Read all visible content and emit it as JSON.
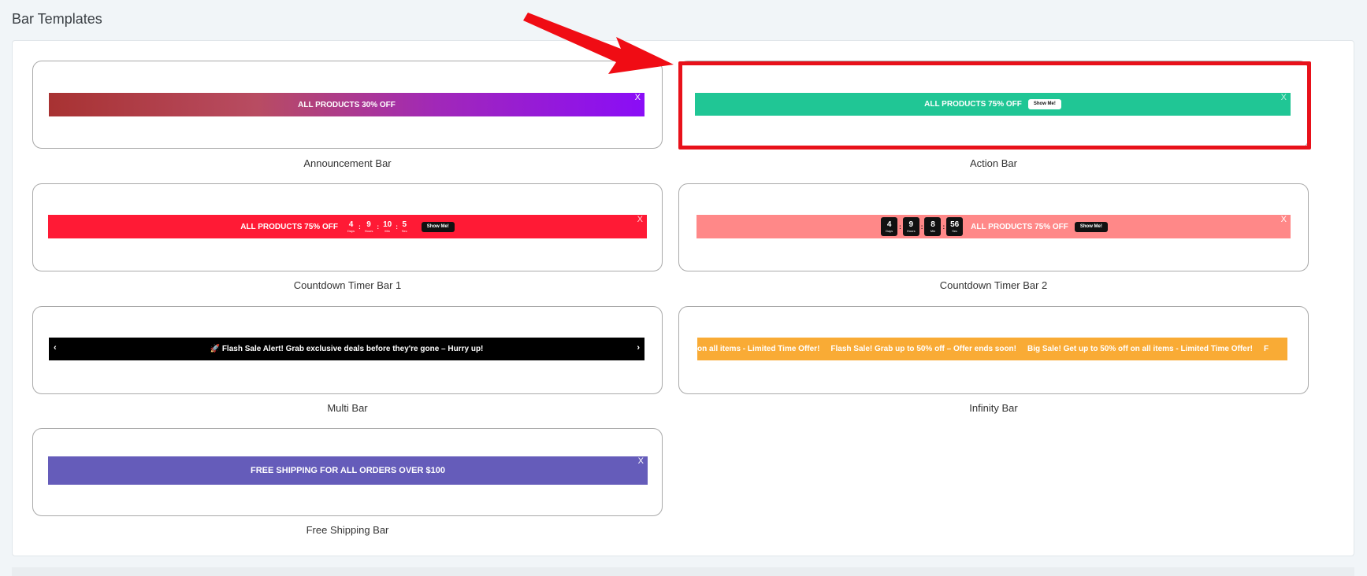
{
  "page": {
    "title": "Bar Templates"
  },
  "templates": [
    {
      "label": "Announcement Bar",
      "text": "ALL PRODUCTS 30% OFF",
      "close": "X"
    },
    {
      "label": "Action Bar",
      "text": "ALL PRODUCTS 75% OFF",
      "button": "Show Me!",
      "close": "X"
    },
    {
      "label": "Countdown Timer Bar 1",
      "text": "ALL PRODUCTS 75% OFF",
      "button": "Show Me!",
      "close": "X",
      "countdown": [
        {
          "value": "4",
          "unit": "Days"
        },
        {
          "value": "9",
          "unit": "Hours"
        },
        {
          "value": "10",
          "unit": "Min"
        },
        {
          "value": "5",
          "unit": "Sec"
        }
      ]
    },
    {
      "label": "Countdown Timer Bar 2",
      "text": "ALL PRODUCTS 75% OFF",
      "button": "Show Me!",
      "close": "X",
      "countdown": [
        {
          "value": "4",
          "unit": "Days"
        },
        {
          "value": "9",
          "unit": "Hours"
        },
        {
          "value": "8",
          "unit": "Min"
        },
        {
          "value": "56",
          "unit": "Sec"
        }
      ]
    },
    {
      "label": "Multi Bar",
      "text": "🚀 Flash Sale Alert! Grab exclusive deals before they're gone – Hurry up!",
      "prev": "‹",
      "next": "›"
    },
    {
      "label": "Infinity Bar",
      "marquee": [
        "on all items - Limited Time Offer!",
        "Flash Sale! Grab up to 50% off – Offer ends soon!",
        "Big Sale! Get up to 50% off on all items - Limited Time Offer!",
        "F"
      ]
    },
    {
      "label": "Free Shipping Bar",
      "text": "FREE SHIPPING FOR ALL ORDERS OVER $100",
      "close": "X"
    }
  ],
  "colors": {
    "announcement_gradient": [
      "#a83232",
      "#b84c62",
      "#8a0df7"
    ],
    "action": "#20c695",
    "countdown1": "#ff1a35",
    "countdown2": "#ff8888",
    "multi": "#000000",
    "infinity": "#f9ab35",
    "free_shipping": "#655cba",
    "highlight": "#e8111a"
  }
}
